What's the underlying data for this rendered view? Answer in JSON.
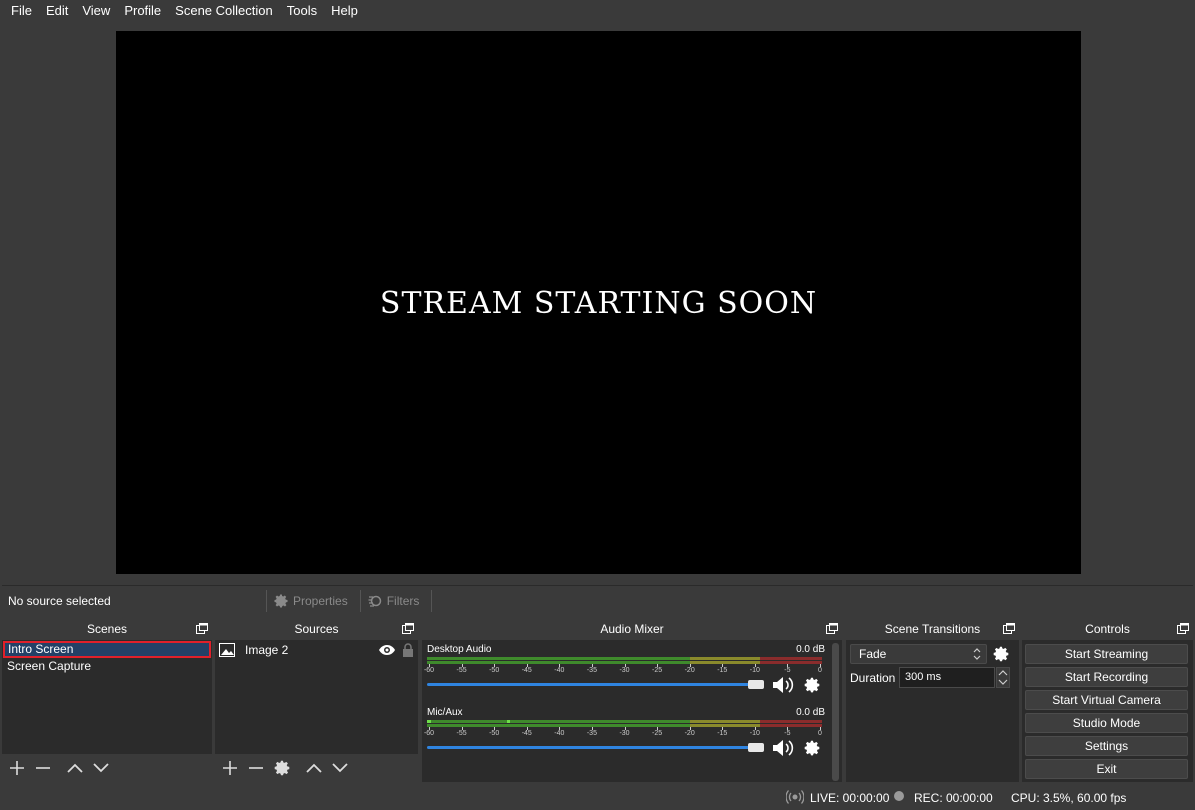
{
  "menu": [
    "File",
    "Edit",
    "View",
    "Profile",
    "Scene Collection",
    "Tools",
    "Help"
  ],
  "preview": {
    "text": "STREAM STARTING SOON"
  },
  "context_bar": {
    "status": "No source selected",
    "properties_label": "Properties",
    "filters_label": "Filters"
  },
  "scenes": {
    "title": "Scenes",
    "items": [
      {
        "label": "Intro Screen",
        "selected": true
      },
      {
        "label": "Screen Capture",
        "selected": false
      }
    ]
  },
  "sources": {
    "title": "Sources",
    "items": [
      {
        "label": "Image 2",
        "type_icon": "image-icon",
        "visible": true,
        "locked": true
      }
    ]
  },
  "audio_mixer": {
    "title": "Audio Mixer",
    "tick_labels": [
      "-60",
      "-55",
      "-50",
      "-45",
      "-40",
      "-35",
      "-30",
      "-25",
      "-20",
      "-15",
      "-10",
      "-5",
      "0"
    ],
    "channels": [
      {
        "name": "Desktop Audio",
        "db": "0.0 dB",
        "volume": 1.0
      },
      {
        "name": "Mic/Aux",
        "db": "0.0 dB",
        "volume": 1.0
      }
    ]
  },
  "scene_transitions": {
    "title": "Scene Transitions",
    "transition": "Fade",
    "duration_label": "Duration",
    "duration_value": "300 ms"
  },
  "controls": {
    "title": "Controls",
    "buttons": [
      "Start Streaming",
      "Start Recording",
      "Start Virtual Camera",
      "Studio Mode",
      "Settings",
      "Exit"
    ]
  },
  "status_bar": {
    "live": "LIVE: 00:00:00",
    "rec": "REC: 00:00:00",
    "cpu": "CPU: 3.5%, 60.00 fps"
  },
  "colors": {
    "background": "#3a3a3a",
    "dock_body": "#2b2b2b",
    "selection": "#234066",
    "highlight_outline": "#e0202a",
    "fader": "#2f84e0",
    "meter_green": "#3f8a2c",
    "meter_yellow": "#8a8a2c",
    "meter_red": "#8a2c2c"
  }
}
